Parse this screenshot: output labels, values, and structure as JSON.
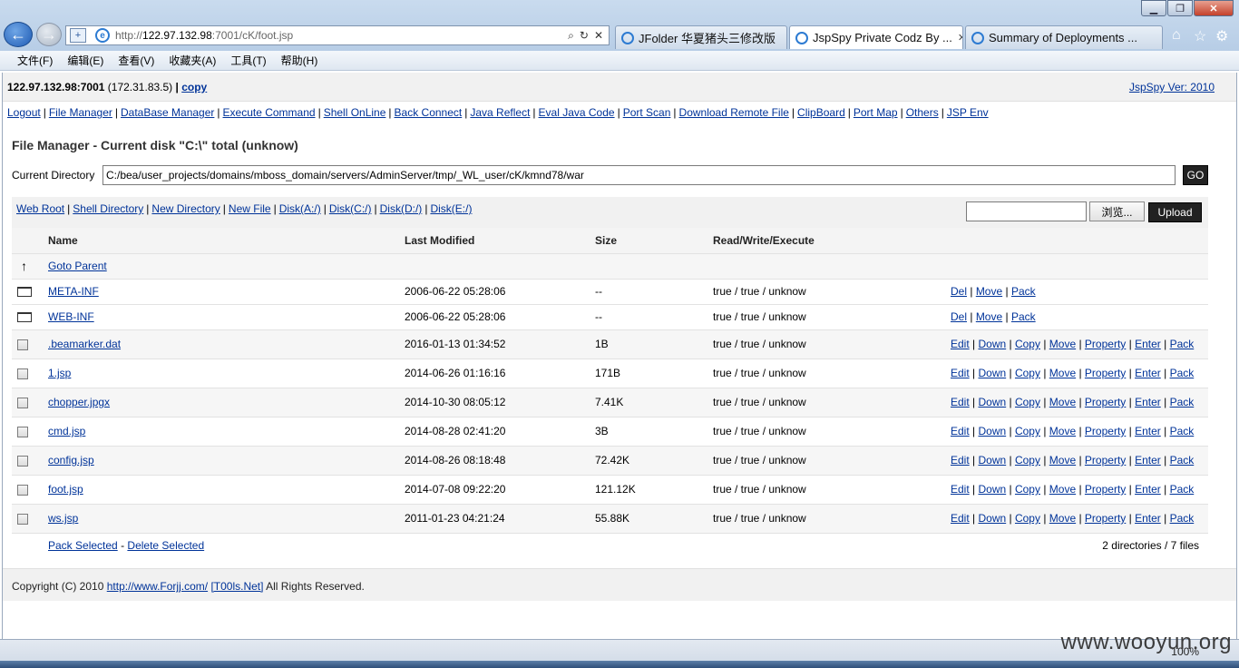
{
  "browser": {
    "url_prefix": "http://",
    "url_host": "122.97.132.98",
    "url_rest": ":7001/cK/foot.jsp",
    "tabs": [
      {
        "label": "JFolder 华夏猪头三修改版"
      },
      {
        "label": "JspSpy Private Codz By ..."
      },
      {
        "label": "Summary of Deployments ..."
      }
    ],
    "menu": [
      "文件(F)",
      "编辑(E)",
      "查看(V)",
      "收藏夹(A)",
      "工具(T)",
      "帮助(H)"
    ],
    "zoom": "100%"
  },
  "header": {
    "host": "122.97.132.98:7001",
    "ip": "(172.31.83.5)",
    "sep": "|",
    "copy_label": "copy",
    "version": "JspSpy Ver: 2010"
  },
  "nav": [
    "Logout",
    "File Manager",
    "DataBase Manager",
    "Execute Command",
    "Shell OnLine",
    "Back Connect",
    "Java Reflect",
    "Eval Java Code",
    "Port Scan",
    "Download Remote File",
    "ClipBoard",
    "Port Map",
    "Others",
    "JSP Env"
  ],
  "file_manager": {
    "title": "File Manager - Current disk \"C:\\\" total (unknow)",
    "current_dir_label": "Current Directory",
    "current_dir": "C:/bea/user_projects/domains/mboss_domain/servers/AdminServer/tmp/_WL_user/cK/kmnd78/war",
    "go_label": "GO",
    "shortcuts": [
      "Web Root",
      "Shell Directory",
      "New Directory",
      "New File",
      "Disk(A:/)",
      "Disk(C:/)",
      "Disk(D:/)",
      "Disk(E:/)"
    ],
    "browse_label": "浏览...",
    "upload_label": "Upload",
    "columns": [
      "Name",
      "Last Modified",
      "Size",
      "Read/Write/Execute"
    ],
    "parent_label": "Goto Parent",
    "dirs": [
      {
        "name": "META-INF",
        "modified": "2006-06-22 05:28:06",
        "size": "--",
        "rwe": "true / true / unknow"
      },
      {
        "name": "WEB-INF",
        "modified": "2006-06-22 05:28:06",
        "size": "--",
        "rwe": "true / true / unknow"
      }
    ],
    "dir_actions": [
      "Del",
      "Move",
      "Pack"
    ],
    "files": [
      {
        "name": ".beamarker.dat",
        "modified": "2016-01-13 01:34:52",
        "size": "1B",
        "rwe": "true / true / unknow"
      },
      {
        "name": "1.jsp",
        "modified": "2014-06-26 01:16:16",
        "size": "171B",
        "rwe": "true / true / unknow"
      },
      {
        "name": "chopper.jpgx",
        "modified": "2014-10-30 08:05:12",
        "size": "7.41K",
        "rwe": "true / true / unknow"
      },
      {
        "name": "cmd.jsp",
        "modified": "2014-08-28 02:41:20",
        "size": "3B",
        "rwe": "true / true / unknow"
      },
      {
        "name": "config.jsp",
        "modified": "2014-08-26 08:18:48",
        "size": "72.42K",
        "rwe": "true / true / unknow"
      },
      {
        "name": "foot.jsp",
        "modified": "2014-07-08 09:22:20",
        "size": "121.12K",
        "rwe": "true / true / unknow"
      },
      {
        "name": "ws.jsp",
        "modified": "2011-01-23 04:21:24",
        "size": "55.88K",
        "rwe": "true / true / unknow"
      }
    ],
    "file_actions": [
      "Edit",
      "Down",
      "Copy",
      "Move",
      "Property",
      "Enter",
      "Pack"
    ],
    "pack_selected": "Pack Selected",
    "dash": "-",
    "delete_selected": "Delete Selected",
    "summary": "2 directories / 7 files"
  },
  "footer": {
    "prefix": "Copyright (C) 2010",
    "link1": "http://www.Forjj.com/",
    "link2": "[T00ls.Net]",
    "suffix": "All Rights Reserved."
  },
  "watermark": "www.wooyun.org"
}
